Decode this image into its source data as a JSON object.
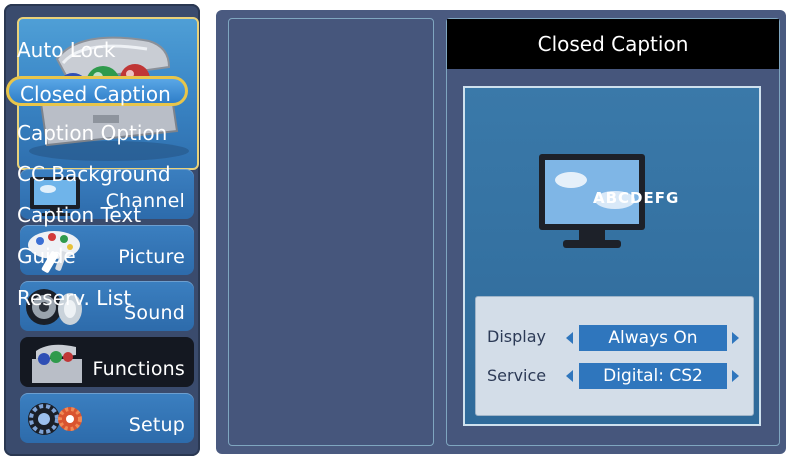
{
  "sidebar": {
    "items": [
      {
        "label": "Channel",
        "icon": "tv-icon"
      },
      {
        "label": "Picture",
        "icon": "paint-palette-icon"
      },
      {
        "label": "Sound",
        "icon": "speaker-icon"
      },
      {
        "label": "Functions",
        "icon": "toolbox-icon",
        "active": true
      },
      {
        "label": "Setup",
        "icon": "gears-icon"
      }
    ]
  },
  "menu": {
    "items": [
      {
        "label": "Auto Lock"
      },
      {
        "label": "Closed Caption",
        "selected": true
      },
      {
        "label": "Caption Option"
      },
      {
        "label": "CC Background"
      },
      {
        "label": "Caption Text"
      },
      {
        "label": "Guide"
      },
      {
        "label": "Reserv. List"
      }
    ]
  },
  "panel": {
    "title": "Closed Caption",
    "preview_caption": "ABCDEFG",
    "settings": [
      {
        "label": "Display",
        "value": "Always On"
      },
      {
        "label": "Service",
        "value": "Digital: CS2"
      }
    ]
  },
  "colors": {
    "nav_blue": "#2f6fae",
    "selection_border": "#e8c54a",
    "option_value_bg": "#2f76bd",
    "title_bar": "#000000"
  }
}
